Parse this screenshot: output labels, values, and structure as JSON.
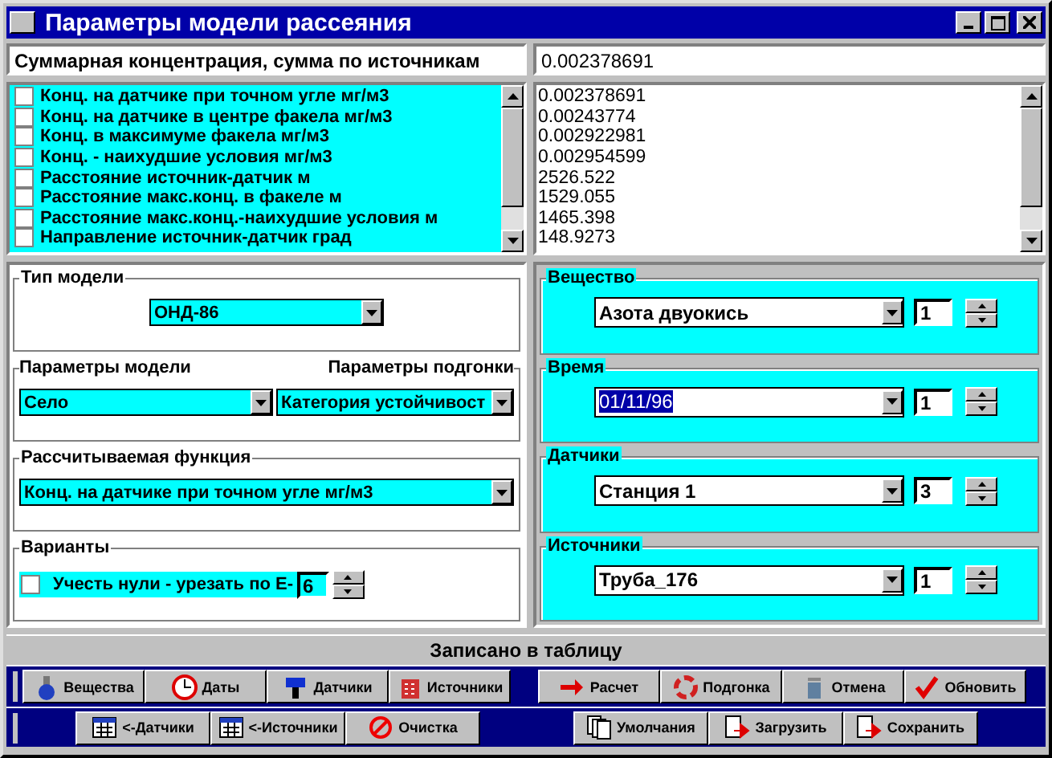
{
  "window": {
    "title": "Параметры модели рассеяния"
  },
  "summary": {
    "label": "Суммарная концентрация, сумма по источникам",
    "value": "0.002378691"
  },
  "functions": [
    {
      "label": "Конц. на датчике при точном угле мг/м3",
      "checked": false
    },
    {
      "label": "Конц. на датчике в центре факела мг/м3",
      "checked": false
    },
    {
      "label": "Конц. в максимуме факела мг/м3",
      "checked": false
    },
    {
      "label": "Конц. - наихудшие условия мг/м3",
      "checked": false
    },
    {
      "label": "Расстояние источник-датчик м",
      "checked": false
    },
    {
      "label": "Расстояние макс.конц. в факеле м",
      "checked": false
    },
    {
      "label": "Расстояние макс.конц.-наихудшие условия м",
      "checked": false
    },
    {
      "label": "Направление источник-датчик град",
      "checked": false
    }
  ],
  "values": [
    "0.002378691",
    "0.00243774",
    "0.002922981",
    "0.002954599",
    "2526.522",
    "1529.055",
    "1465.398",
    "148.9273"
  ],
  "model_type": {
    "title": "Тип модели",
    "value": "ОНД-86"
  },
  "model_params": {
    "title": "Параметры модели",
    "title_right": "Параметры подгонки",
    "value": "Село",
    "value_right": "Категория устойчивост"
  },
  "function": {
    "title": "Рассчитываемая функция",
    "value": "Конц. на датчике при точном угле мг/м3"
  },
  "variants": {
    "title": "Варианты",
    "label": "Учесть нули - урезать по Е-",
    "checked": false,
    "value": "6"
  },
  "selectors": [
    {
      "title": "Вещество",
      "value": "Азота двуокись",
      "count": "1",
      "selected": false
    },
    {
      "title": "Время",
      "value": "01/11/96",
      "count": "1",
      "selected": true
    },
    {
      "title": "Датчики",
      "value": "Станция 1",
      "count": "3",
      "selected": false
    },
    {
      "title": "Источники",
      "value": "Труба_176",
      "count": "1",
      "selected": false
    }
  ],
  "status_bar": "Записано в таблицу",
  "toolbar_top": [
    [
      "Вещества",
      "Даты",
      "Датчики",
      "Источники"
    ],
    [
      "Расчет",
      "Подгонка",
      "Отмена",
      "Обновить"
    ]
  ],
  "toolbar_bottom": [
    [
      "<-Датчики",
      "<-Источники",
      "Очистка"
    ],
    [
      "Умолчания",
      "Загрузить",
      "Сохранить"
    ]
  ]
}
